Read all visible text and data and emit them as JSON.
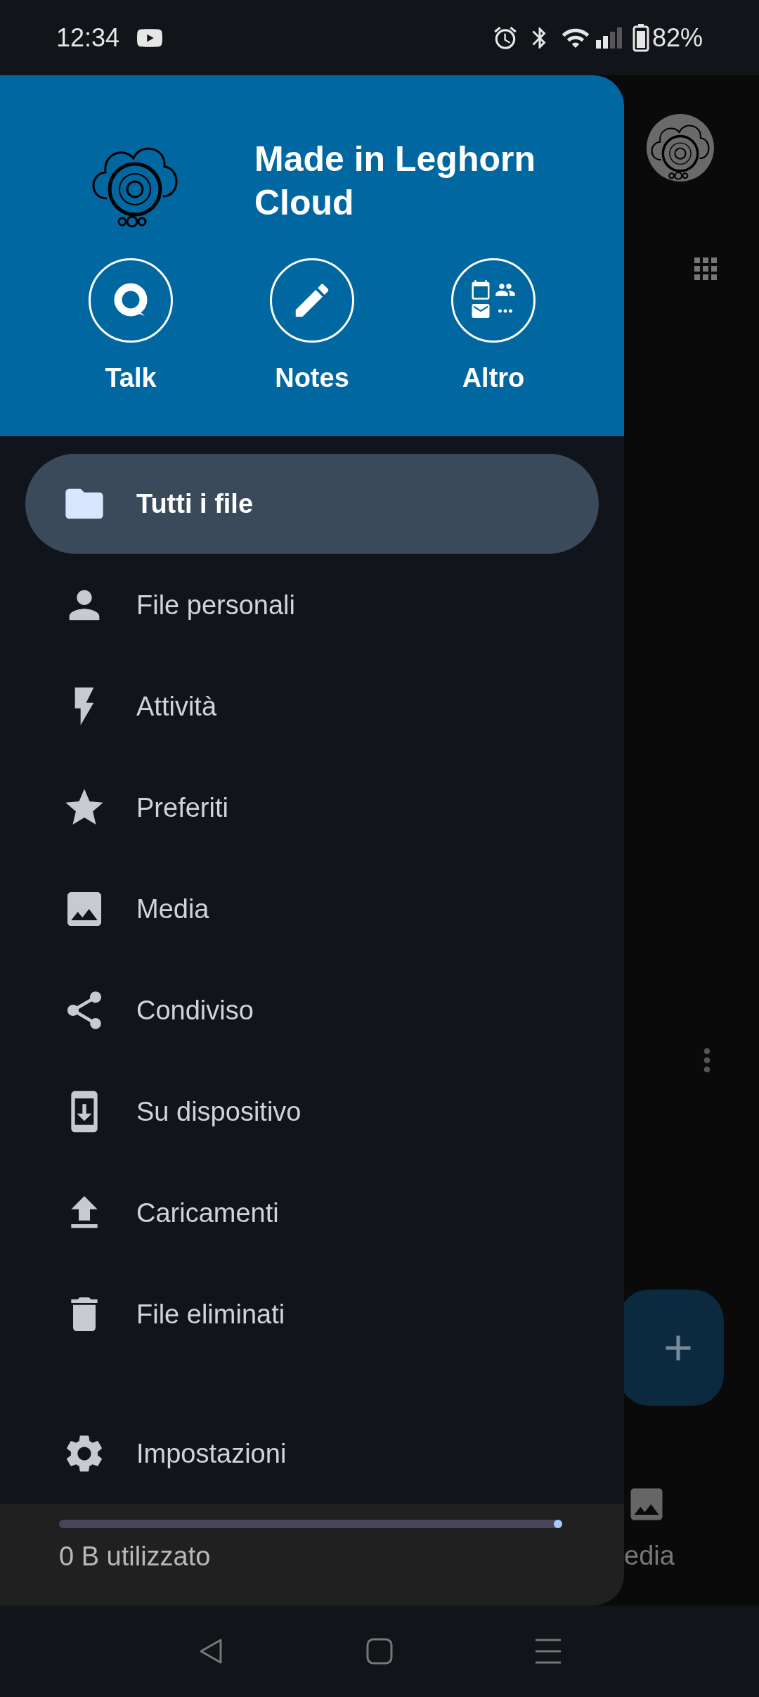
{
  "status_bar": {
    "time": "12:34",
    "battery": "82%"
  },
  "drawer": {
    "title": "Made in Leghorn Cloud",
    "apps": [
      {
        "label": "Talk"
      },
      {
        "label": "Notes"
      },
      {
        "label": "Altro"
      }
    ],
    "items": [
      {
        "label": "Tutti i file",
        "selected": true
      },
      {
        "label": "File personali",
        "selected": false
      },
      {
        "label": "Attività",
        "selected": false
      },
      {
        "label": "Preferiti",
        "selected": false
      },
      {
        "label": "Media",
        "selected": false
      },
      {
        "label": "Condiviso",
        "selected": false
      },
      {
        "label": "Su dispositivo",
        "selected": false
      },
      {
        "label": "Caricamenti",
        "selected": false
      },
      {
        "label": "File eliminati",
        "selected": false
      }
    ],
    "settings": {
      "label": "Impostazioni"
    },
    "storage": {
      "level": 0,
      "label": "0 B utilizzato"
    }
  },
  "background": {
    "bottom_nav_label": "edia"
  }
}
